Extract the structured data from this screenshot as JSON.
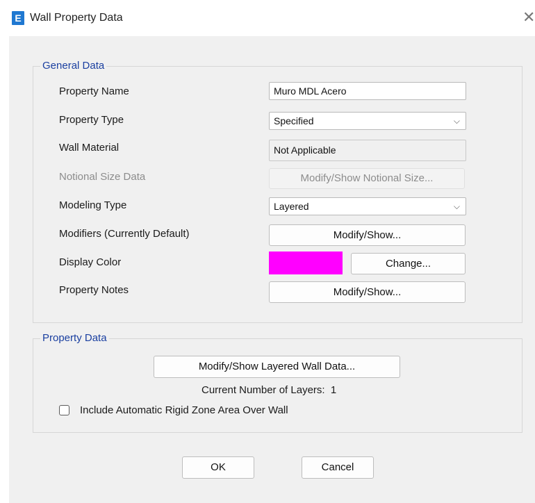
{
  "window": {
    "icon_letter": "E",
    "title": "Wall Property Data",
    "close_glyph": "✕"
  },
  "general": {
    "legend": "General Data",
    "property_name_label": "Property Name",
    "property_name_value": "Muro MDL Acero",
    "property_type_label": "Property Type",
    "property_type_value": "Specified",
    "wall_material_label": "Wall Material",
    "wall_material_value": "Not Applicable",
    "notional_label": "Notional Size Data",
    "notional_button": "Modify/Show Notional Size...",
    "modeling_type_label": "Modeling Type",
    "modeling_type_value": "Layered",
    "modifiers_label": "Modifiers (Currently Default)",
    "modifiers_button": "Modify/Show...",
    "display_color_label": "Display Color",
    "display_color_value": "#ff00ff",
    "change_button": "Change...",
    "notes_label": "Property Notes",
    "notes_button": "Modify/Show..."
  },
  "property_data": {
    "legend": "Property Data",
    "layered_button": "Modify/Show Layered Wall Data...",
    "layers_text": "Current Number of Layers:  1",
    "rigid_zone_label": "Include Automatic Rigid Zone Area Over Wall",
    "rigid_zone_checked": false
  },
  "footer": {
    "ok": "OK",
    "cancel": "Cancel"
  },
  "icons": {
    "dropdown": "chevron-down-icon",
    "close": "close-icon",
    "app": "etabs-app-icon"
  }
}
